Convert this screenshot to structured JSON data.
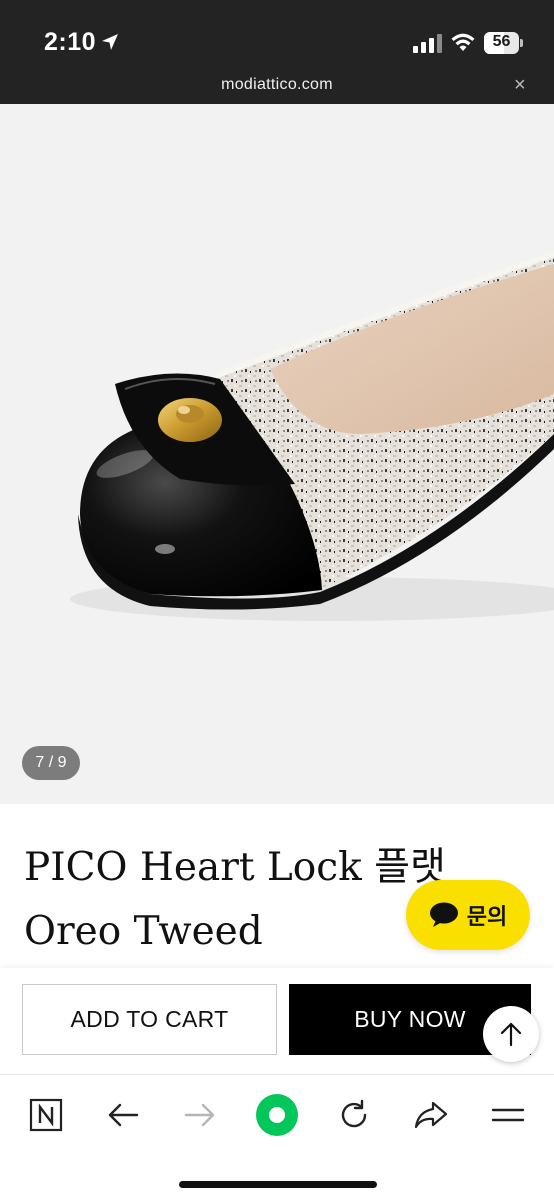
{
  "status_bar": {
    "time": "2:10",
    "battery": "56",
    "battery_level": 0.56
  },
  "address_bar": {
    "url": "modiattico.com",
    "close_label": "×"
  },
  "gallery": {
    "counter": "7 / 9",
    "current": 7,
    "total": 9
  },
  "product": {
    "title": "PICO Heart Lock 플랫 Oreo Tweed"
  },
  "chat": {
    "label": "문의",
    "color": "#f9e000"
  },
  "actions": {
    "add_to_cart": "ADD TO CART",
    "buy_now": "BUY NOW"
  },
  "toolbar": {
    "icons": [
      "naver-icon",
      "back-icon",
      "forward-icon",
      "green-dot-icon",
      "reload-icon",
      "share-icon",
      "menu-icon"
    ],
    "accent": "#03c75a"
  }
}
